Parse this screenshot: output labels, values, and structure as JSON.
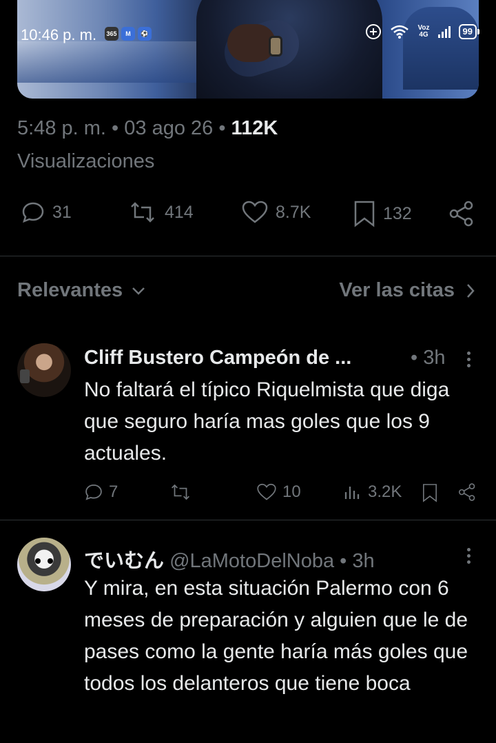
{
  "status_bar": {
    "time": "10:46 p. m.",
    "apps": [
      "365",
      "M",
      "⚽"
    ],
    "voz_top": "Voz",
    "voz_bottom": "4G",
    "battery": "99"
  },
  "tweet": {
    "time": "5:48 p. m.",
    "date": "03 ago 26",
    "views_count": "112K",
    "views_label": "Visualizaciones",
    "stats": {
      "replies": "31",
      "reposts": "414",
      "likes": "8.7K",
      "bookmarks": "132"
    }
  },
  "sort": {
    "relevantes": "Relevantes",
    "ver_citas": "Ver las citas"
  },
  "replies": [
    {
      "name": "Cliff Bustero Campeón de ...",
      "handle": "",
      "time": "• 3h",
      "text": "No faltará el típico Riquelmista que diga que seguro haría mas goles que los 9 actuales.",
      "replies": "7",
      "reposts": "",
      "likes": "10",
      "views": "3.2K"
    },
    {
      "name": "でいむん",
      "handle": "@LaMotoDelNoba",
      "time": "• 3h",
      "text": "Y mira, en esta situación Palermo con 6 meses de preparación y alguien que le de pases como la gente haría más goles que todos los delanteros que tiene boca"
    }
  ]
}
